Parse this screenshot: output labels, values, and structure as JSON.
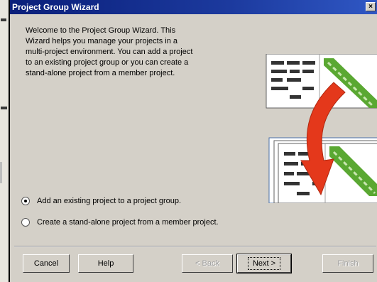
{
  "window": {
    "title": "Project Group Wizard",
    "close_glyph": "×"
  },
  "welcome_text": "Welcome to the Project Group Wizard.  This\nWizard helps you manage your projects in a\nmulti-project environment.  You can add a project\nto an existing project group or you can create a\nstand-alone project from a member project.",
  "options": [
    {
      "label": "Add an existing project to a project group.",
      "selected": true
    },
    {
      "label": "Create a stand-alone project from a member project.",
      "selected": false
    }
  ],
  "buttons": {
    "cancel": "Cancel",
    "help": "Help",
    "back": "< Back",
    "next": "Next >",
    "finish": "Finish"
  },
  "icons": {
    "arrow": "curved-arrow-icon",
    "group_documents": "project-group-documents-icon",
    "single_document": "project-document-icon"
  },
  "colors": {
    "titlebar": "#0a1f7a",
    "arrow": "#e4381b",
    "diagram_stripe": "#5aa832"
  }
}
